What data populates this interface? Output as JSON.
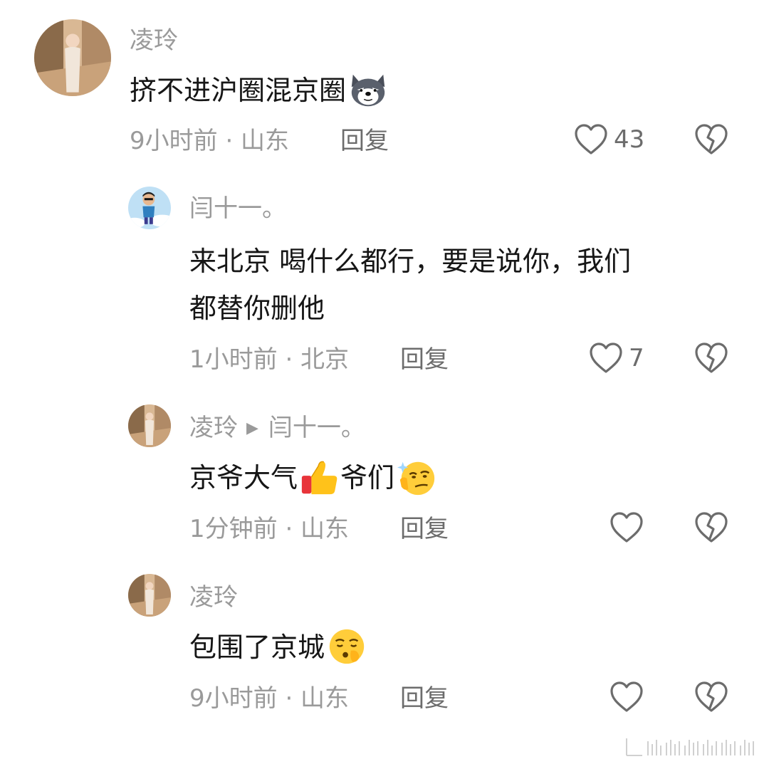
{
  "comments": [
    {
      "user": "凌玲",
      "text": "挤不进沪圈混京圈",
      "emojis": [
        "dog-face-emoji"
      ],
      "meta": "9小时前 · 山东",
      "reply_label": "回复",
      "likes": "43"
    },
    {
      "user": "闫十一。",
      "text_line1": "来北京 喝什么都行，要是说你，我们",
      "text_line2": "都替你删他",
      "meta": "1小时前 · 北京",
      "reply_label": "回复",
      "likes": "7"
    },
    {
      "user": "凌玲",
      "reply_to": "闫十一。",
      "text_part1": "京爷大气",
      "text_part2": "爷们",
      "emojis": [
        "thumbs-up-emoji",
        "smirk-face-emoji"
      ],
      "meta": "1分钟前 · 山东",
      "reply_label": "回复",
      "likes": ""
    },
    {
      "user": "凌玲",
      "text": "包围了京城",
      "emojis": [
        "shush-face-emoji"
      ],
      "meta": "9小时前 · 山东",
      "reply_label": "回复",
      "likes": ""
    }
  ],
  "icons": {
    "like": "heart-outline-icon",
    "dislike": "broken-heart-icon",
    "reply_arrow": "triangle-right-icon"
  },
  "colors": {
    "secondary_text": "#9a9a9a",
    "primary_text": "#161616",
    "icon_gray": "#6c6c6c"
  }
}
